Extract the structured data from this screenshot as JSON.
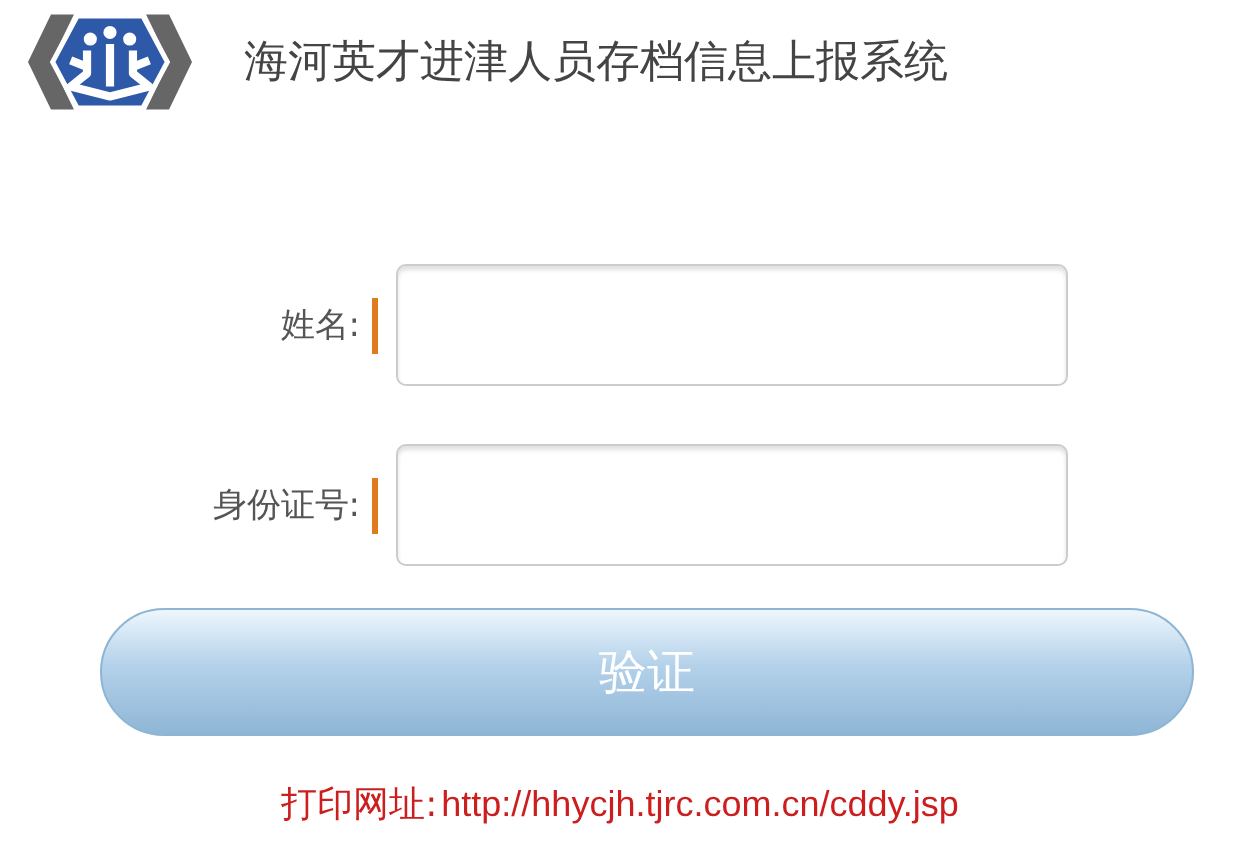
{
  "header": {
    "title": "海河英才进津人员存档信息上报系统"
  },
  "fields": [
    {
      "label": "姓名:"
    },
    {
      "label": "身份证号:"
    }
  ],
  "submit_button": {
    "label": "验证"
  },
  "footer": {
    "label": "打印网址:",
    "url": "http://hhycjh.tjrc.com.cn/cddy.jsp"
  }
}
